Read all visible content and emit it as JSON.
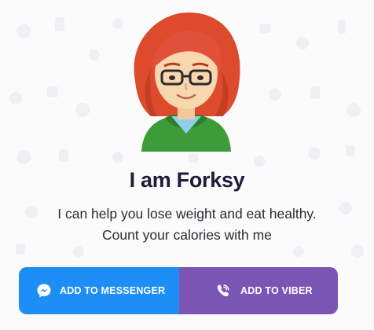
{
  "hero": {
    "title": "I am Forksy",
    "subtitle_line1": "I can help you lose weight and eat healthy.",
    "subtitle_line2": "Count your calories with me"
  },
  "actions": {
    "messenger_label": "ADD TO MESSENGER",
    "viber_label": "ADD TO VIBER"
  },
  "icons": {
    "avatar": "forksy-avatar",
    "messenger": "messenger-icon",
    "viber": "viber-icon"
  },
  "colors": {
    "messenger": "#1c8ef6",
    "viber": "#7b55b4",
    "title": "#1f1b3a",
    "hair": "#e0462e",
    "hoodie": "#3e9b3a"
  }
}
